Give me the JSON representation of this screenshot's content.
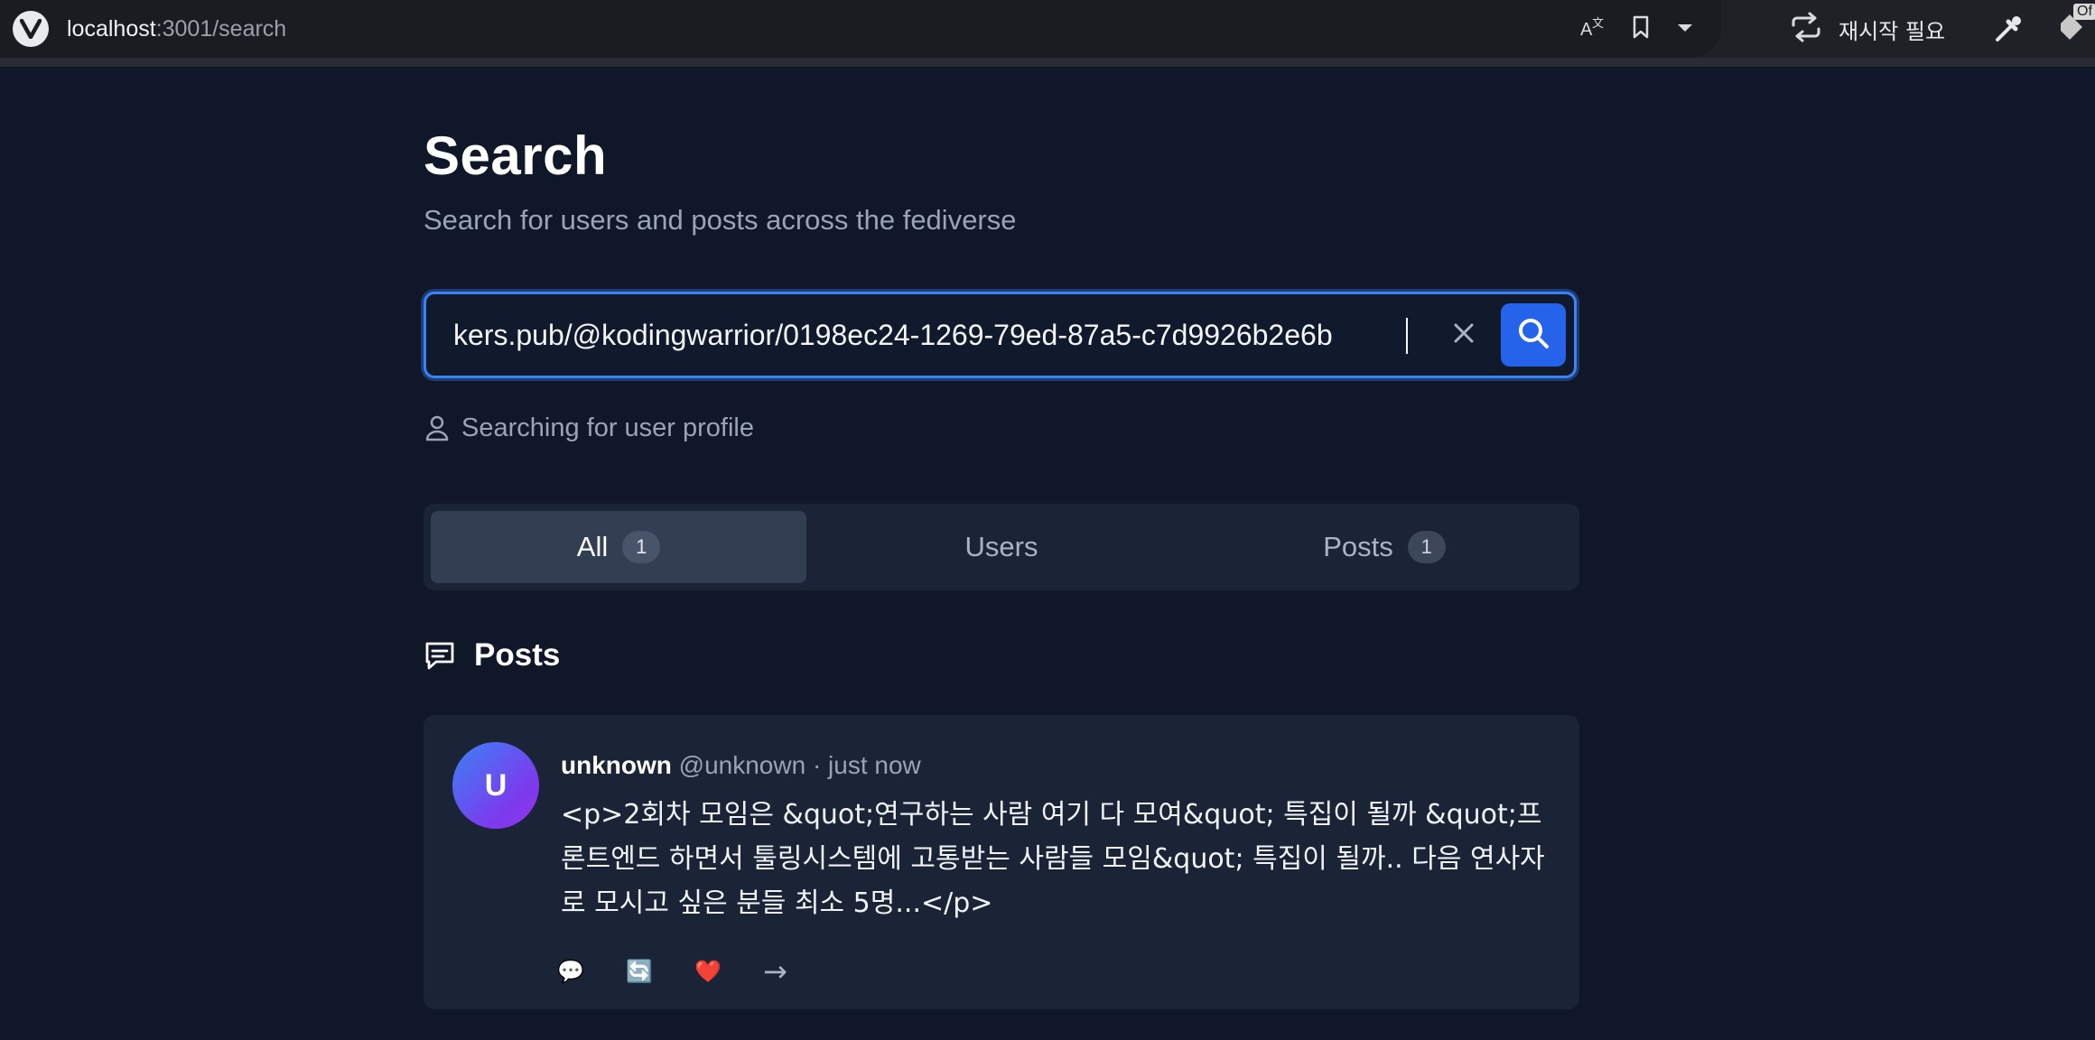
{
  "browser": {
    "url_host": "localhost",
    "url_path": ":3001/search",
    "restart_label": "재시작 필요",
    "ext_badge": "Of"
  },
  "page": {
    "title": "Search",
    "subtitle": "Search for users and posts across the fediverse"
  },
  "search": {
    "value": "kers.pub/@kodingwarrior/0198ec24-1269-79ed-87a5-c7d9926b2e6b",
    "hint": "Searching for user profile"
  },
  "tabs": [
    {
      "label": "All",
      "count": "1"
    },
    {
      "label": "Users"
    },
    {
      "label": "Posts",
      "count": "1"
    }
  ],
  "section": {
    "title": "Posts"
  },
  "post": {
    "avatar_letter": "U",
    "author_name": "unknown",
    "meta": " @unknown · just now",
    "body": "<p>2회차 모임은 &quot;연구하는 사람 여기 다 모여&quot; 특집이 될까 &quot;프론트엔드 하면서 툴링시스템에 고통받는 사람들 모임&quot; 특집이 될까.. 다음 연사자로 모시고 싶은 분들 최소 5명...</p>",
    "actions": {
      "reply_glyph": "💬",
      "boost_glyph": "🔄",
      "like_glyph": "❤️",
      "open_glyph": "→"
    }
  },
  "colors": {
    "background": "#0f1729",
    "card": "#1a2436",
    "accent": "#2563eb",
    "focus_ring": "#3b82f6"
  }
}
